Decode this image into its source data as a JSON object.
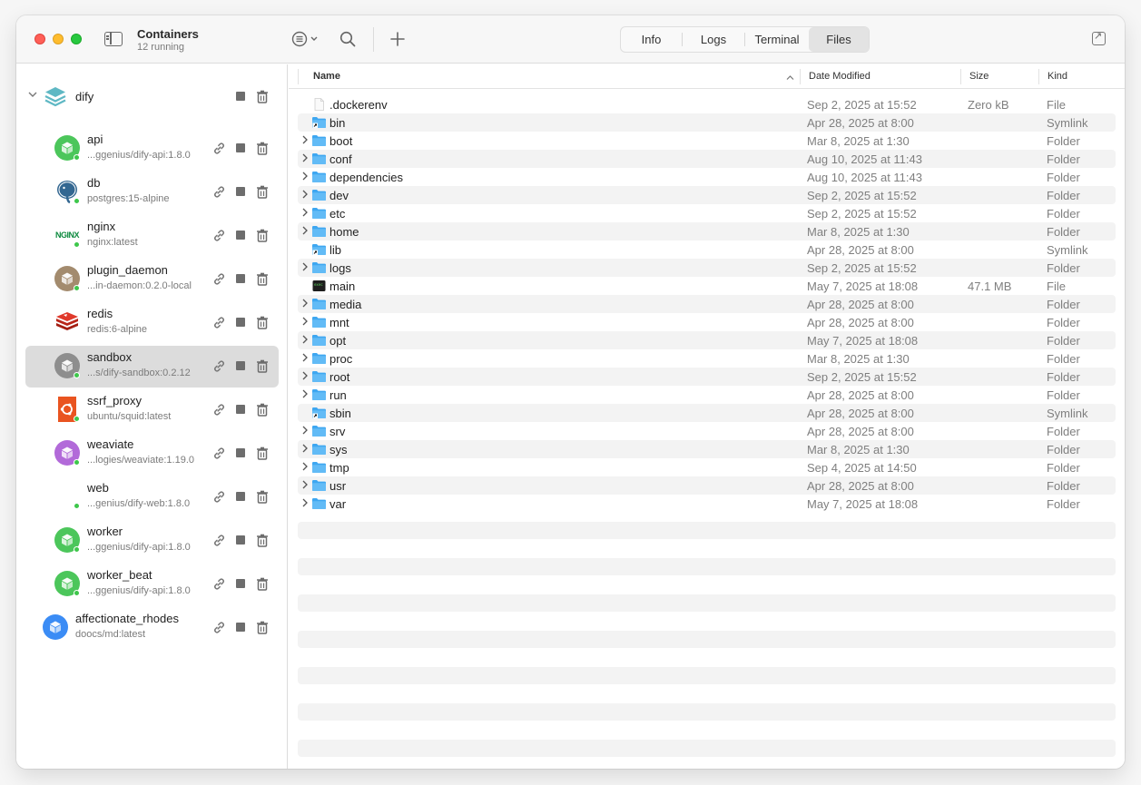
{
  "window": {
    "title": "Containers",
    "subtitle": "12 running"
  },
  "tabs": [
    {
      "label": "Info",
      "active": false
    },
    {
      "label": "Logs",
      "active": false
    },
    {
      "label": "Terminal",
      "active": false
    },
    {
      "label": "Files",
      "active": true
    }
  ],
  "sidebar": {
    "group": {
      "name": "dify",
      "expanded": true
    },
    "containers": [
      {
        "name": "api",
        "image": "...ggenius/dify-api:1.8.0",
        "icon": "cube-icon",
        "color": "#4cc65b",
        "running": true
      },
      {
        "name": "db",
        "image": "postgres:15-alpine",
        "icon": "postgres-icon",
        "color": "#336791",
        "running": true
      },
      {
        "name": "nginx",
        "image": "nginx:latest",
        "icon": "nginx-icon",
        "color": "#0c8a3e",
        "running": true
      },
      {
        "name": "plugin_daemon",
        "image": "...in-daemon:0.2.0-local",
        "icon": "cube-icon",
        "color": "#a38b6e",
        "running": true
      },
      {
        "name": "redis",
        "image": "redis:6-alpine",
        "icon": "redis-icon",
        "color": "#d82c20",
        "running": false
      },
      {
        "name": "sandbox",
        "image": "...s/dify-sandbox:0.2.12",
        "icon": "cube-icon",
        "color": "#8e8e8e",
        "running": true,
        "selected": true
      },
      {
        "name": "ssrf_proxy",
        "image": "ubuntu/squid:latest",
        "icon": "ubuntu-icon",
        "color": "#e95420",
        "running": true
      },
      {
        "name": "weaviate",
        "image": "...logies/weaviate:1.19.0",
        "icon": "cube-icon",
        "color": "#b26ad9",
        "running": true
      },
      {
        "name": "web",
        "image": "...genius/dify-web:1.8.0",
        "icon": "blank-icon",
        "color": "#ffffff",
        "running": true
      },
      {
        "name": "worker",
        "image": "...ggenius/dify-api:1.8.0",
        "icon": "cube-icon",
        "color": "#4cc65b",
        "running": true
      },
      {
        "name": "worker_beat",
        "image": "...ggenius/dify-api:1.8.0",
        "icon": "cube-icon",
        "color": "#4cc65b",
        "running": true
      }
    ],
    "standalone": [
      {
        "name": "affectionate_rhodes",
        "image": "doocs/md:latest",
        "icon": "cube-icon",
        "color": "#3b8cf5",
        "running": false
      }
    ]
  },
  "files": {
    "columns": {
      "name": "Name",
      "date": "Date Modified",
      "size": "Size",
      "kind": "Kind"
    },
    "rows": [
      {
        "name": ".dockerenv",
        "date": "Sep 2, 2025 at 15:52",
        "size": "Zero kB",
        "kind": "File",
        "type": "file"
      },
      {
        "name": "bin",
        "date": "Apr 28, 2025 at 8:00",
        "size": "",
        "kind": "Symlink",
        "type": "symlink"
      },
      {
        "name": "boot",
        "date": "Mar 8, 2025 at 1:30",
        "size": "",
        "kind": "Folder",
        "type": "folder"
      },
      {
        "name": "conf",
        "date": "Aug 10, 2025 at 11:43",
        "size": "",
        "kind": "Folder",
        "type": "folder"
      },
      {
        "name": "dependencies",
        "date": "Aug 10, 2025 at 11:43",
        "size": "",
        "kind": "Folder",
        "type": "folder"
      },
      {
        "name": "dev",
        "date": "Sep 2, 2025 at 15:52",
        "size": "",
        "kind": "Folder",
        "type": "folder"
      },
      {
        "name": "etc",
        "date": "Sep 2, 2025 at 15:52",
        "size": "",
        "kind": "Folder",
        "type": "folder"
      },
      {
        "name": "home",
        "date": "Mar 8, 2025 at 1:30",
        "size": "",
        "kind": "Folder",
        "type": "folder"
      },
      {
        "name": "lib",
        "date": "Apr 28, 2025 at 8:00",
        "size": "",
        "kind": "Symlink",
        "type": "symlink"
      },
      {
        "name": "logs",
        "date": "Sep 2, 2025 at 15:52",
        "size": "",
        "kind": "Folder",
        "type": "folder"
      },
      {
        "name": "main",
        "date": "May 7, 2025 at 18:08",
        "size": "47.1 MB",
        "kind": "File",
        "type": "exec"
      },
      {
        "name": "media",
        "date": "Apr 28, 2025 at 8:00",
        "size": "",
        "kind": "Folder",
        "type": "folder"
      },
      {
        "name": "mnt",
        "date": "Apr 28, 2025 at 8:00",
        "size": "",
        "kind": "Folder",
        "type": "folder"
      },
      {
        "name": "opt",
        "date": "May 7, 2025 at 18:08",
        "size": "",
        "kind": "Folder",
        "type": "folder"
      },
      {
        "name": "proc",
        "date": "Mar 8, 2025 at 1:30",
        "size": "",
        "kind": "Folder",
        "type": "folder"
      },
      {
        "name": "root",
        "date": "Sep 2, 2025 at 15:52",
        "size": "",
        "kind": "Folder",
        "type": "folder"
      },
      {
        "name": "run",
        "date": "Apr 28, 2025 at 8:00",
        "size": "",
        "kind": "Folder",
        "type": "folder"
      },
      {
        "name": "sbin",
        "date": "Apr 28, 2025 at 8:00",
        "size": "",
        "kind": "Symlink",
        "type": "symlink"
      },
      {
        "name": "srv",
        "date": "Apr 28, 2025 at 8:00",
        "size": "",
        "kind": "Folder",
        "type": "folder"
      },
      {
        "name": "sys",
        "date": "Mar 8, 2025 at 1:30",
        "size": "",
        "kind": "Folder",
        "type": "folder"
      },
      {
        "name": "tmp",
        "date": "Sep 4, 2025 at 14:50",
        "size": "",
        "kind": "Folder",
        "type": "folder"
      },
      {
        "name": "usr",
        "date": "Apr 28, 2025 at 8:00",
        "size": "",
        "kind": "Folder",
        "type": "folder"
      },
      {
        "name": "var",
        "date": "May 7, 2025 at 18:08",
        "size": "",
        "kind": "Folder",
        "type": "folder"
      }
    ]
  },
  "colors": {
    "accent_folder": "#3ea7f1",
    "running_dot": "#3ec74b"
  }
}
